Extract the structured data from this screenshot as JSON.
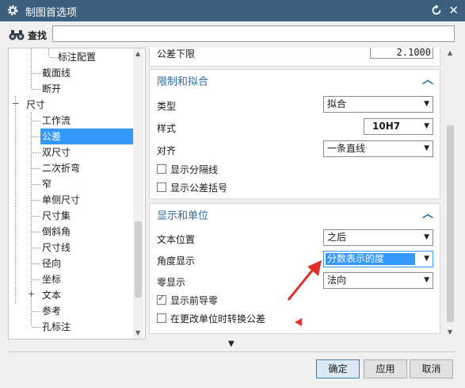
{
  "window": {
    "title": "制图首选项"
  },
  "find": {
    "label": "查找",
    "value": ""
  },
  "tree": {
    "items": [
      {
        "label": "标注配置",
        "selected": false
      },
      {
        "label": "截面线",
        "selected": false
      },
      {
        "label": "断开",
        "selected": false
      },
      {
        "label": "尺寸",
        "selected": false,
        "toggle": "−"
      },
      {
        "label": "工作流",
        "selected": false
      },
      {
        "label": "公差",
        "selected": true
      },
      {
        "label": "双尺寸",
        "selected": false
      },
      {
        "label": "二次折弯",
        "selected": false
      },
      {
        "label": "窄",
        "selected": false
      },
      {
        "label": "单侧尺寸",
        "selected": false
      },
      {
        "label": "尺寸集",
        "selected": false
      },
      {
        "label": "倒斜角",
        "selected": false
      },
      {
        "label": "尺寸线",
        "selected": false
      },
      {
        "label": "径向",
        "selected": false
      },
      {
        "label": "坐标",
        "selected": false
      },
      {
        "label": "文本",
        "selected": false,
        "toggle": "+"
      },
      {
        "label": "参考",
        "selected": false
      },
      {
        "label": "孔标注",
        "selected": false
      }
    ]
  },
  "pane": {
    "tolerance_lower": {
      "label": "公差下限",
      "value": "2.1000"
    },
    "limits_fits": {
      "header": "限制和拟合",
      "type": {
        "label": "类型",
        "value": "拟合"
      },
      "style": {
        "label": "样式",
        "value": "10H7"
      },
      "align": {
        "label": "对齐",
        "value": "一条直线"
      },
      "show_separator": {
        "label": "显示分隔线",
        "checked": false
      },
      "show_brackets": {
        "label": "显示公差括号",
        "checked": false
      }
    },
    "display_units": {
      "header": "显示和单位",
      "text_position": {
        "label": "文本位置",
        "value": "之后"
      },
      "angle_display": {
        "label": "角度显示",
        "value": "分数表示的度"
      },
      "zero_display": {
        "label": "零显示",
        "value": "法向"
      },
      "show_leading_zero": {
        "label": "显示前导零",
        "checked": true
      },
      "convert_on_unit_change": {
        "label": "在更改单位时转换公差",
        "checked": false
      }
    }
  },
  "buttons": {
    "ok": "确定",
    "apply": "应用",
    "cancel": "取消"
  },
  "colors": {
    "titlebar": "#3c5f7e",
    "accent": "#2b6da5",
    "selection": "#3399ff",
    "annotation": "#e0302a"
  }
}
